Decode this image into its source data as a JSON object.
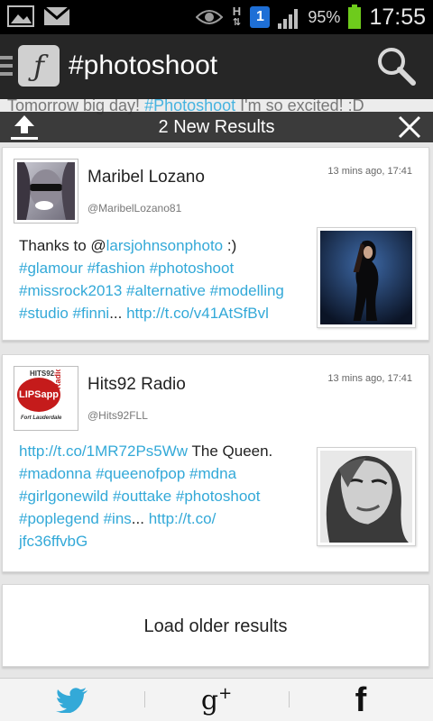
{
  "status_bar": {
    "battery_percent": "95%",
    "time": "17:55",
    "notification_badge": "1",
    "network_letter": "H",
    "icons": [
      "image-icon",
      "gmail-icon",
      "eye-icon",
      "network-h-icon",
      "notification-badge-icon",
      "signal-icon",
      "battery-icon"
    ],
    "battery_color": "#6ecb1c"
  },
  "action_bar": {
    "title": "#photoshoot",
    "logo_glyph": "ƒ",
    "icons": [
      "menu-icon",
      "app-logo-icon",
      "search-icon"
    ]
  },
  "banner": {
    "background_text_prefix": "Tomorrow big day! ",
    "background_text_hashtag": "#Photoshoot",
    "background_text_suffix": " I'm so excited! :D",
    "label": "2 New Results",
    "icons": [
      "upload-icon",
      "close-icon"
    ]
  },
  "results": [
    {
      "name": "Maribel Lozano",
      "handle": "@MaribelLozano81",
      "time": "13 mins ago, 17:41",
      "tweet_parts": [
        {
          "text": "Thanks to @",
          "link": false
        },
        {
          "text": "larsjohnsonphoto",
          "link": true
        },
        {
          "text": " :)",
          "link": false
        },
        {
          "text": "\n",
          "link": false
        },
        {
          "text": "#glamour #fashion #photoshoot",
          "link": true
        },
        {
          "text": "\n",
          "link": false
        },
        {
          "text": "#missrock2013 #alternative #modelling",
          "link": true
        },
        {
          "text": "\n",
          "link": false
        },
        {
          "text": "#studio #finni",
          "link": true
        },
        {
          "text": "... ",
          "link": false
        },
        {
          "text": "http://t.co/v41AtSfBvl",
          "link": true
        }
      ]
    },
    {
      "name": "Hits92 Radio",
      "handle": "@Hits92FLL",
      "time": "13 mins ago, 17:41",
      "avatar_text": {
        "top": "HITS92",
        "main": "LIPSapp",
        "side": "Radio",
        "bottom": "Fort Lauderdale"
      },
      "tweet_parts": [
        {
          "text": "http://t.co/1MR72Ps5Ww",
          "link": true
        },
        {
          "text": " The Queen.",
          "link": false
        },
        {
          "text": "\n",
          "link": false
        },
        {
          "text": "#madonna #queenofpop #mdna",
          "link": true
        },
        {
          "text": "\n",
          "link": false
        },
        {
          "text": "#girlgonewild #outtake #photoshoot",
          "link": true
        },
        {
          "text": "\n",
          "link": false
        },
        {
          "text": "#poplegend #ins",
          "link": true
        },
        {
          "text": "... ",
          "link": false
        },
        {
          "text": "http://t.co/",
          "link": true
        },
        {
          "text": "\n",
          "link": false
        },
        {
          "text": "jfc36ffvbG",
          "link": true
        }
      ]
    }
  ],
  "load_older_label": "Load older results",
  "share_bar": {
    "icons": [
      "twitter-icon",
      "google-plus-icon",
      "facebook-icon"
    ],
    "gplus_label": "g",
    "gplus_plus": "+",
    "facebook_label": "f",
    "twitter_color": "#33a9d8"
  }
}
